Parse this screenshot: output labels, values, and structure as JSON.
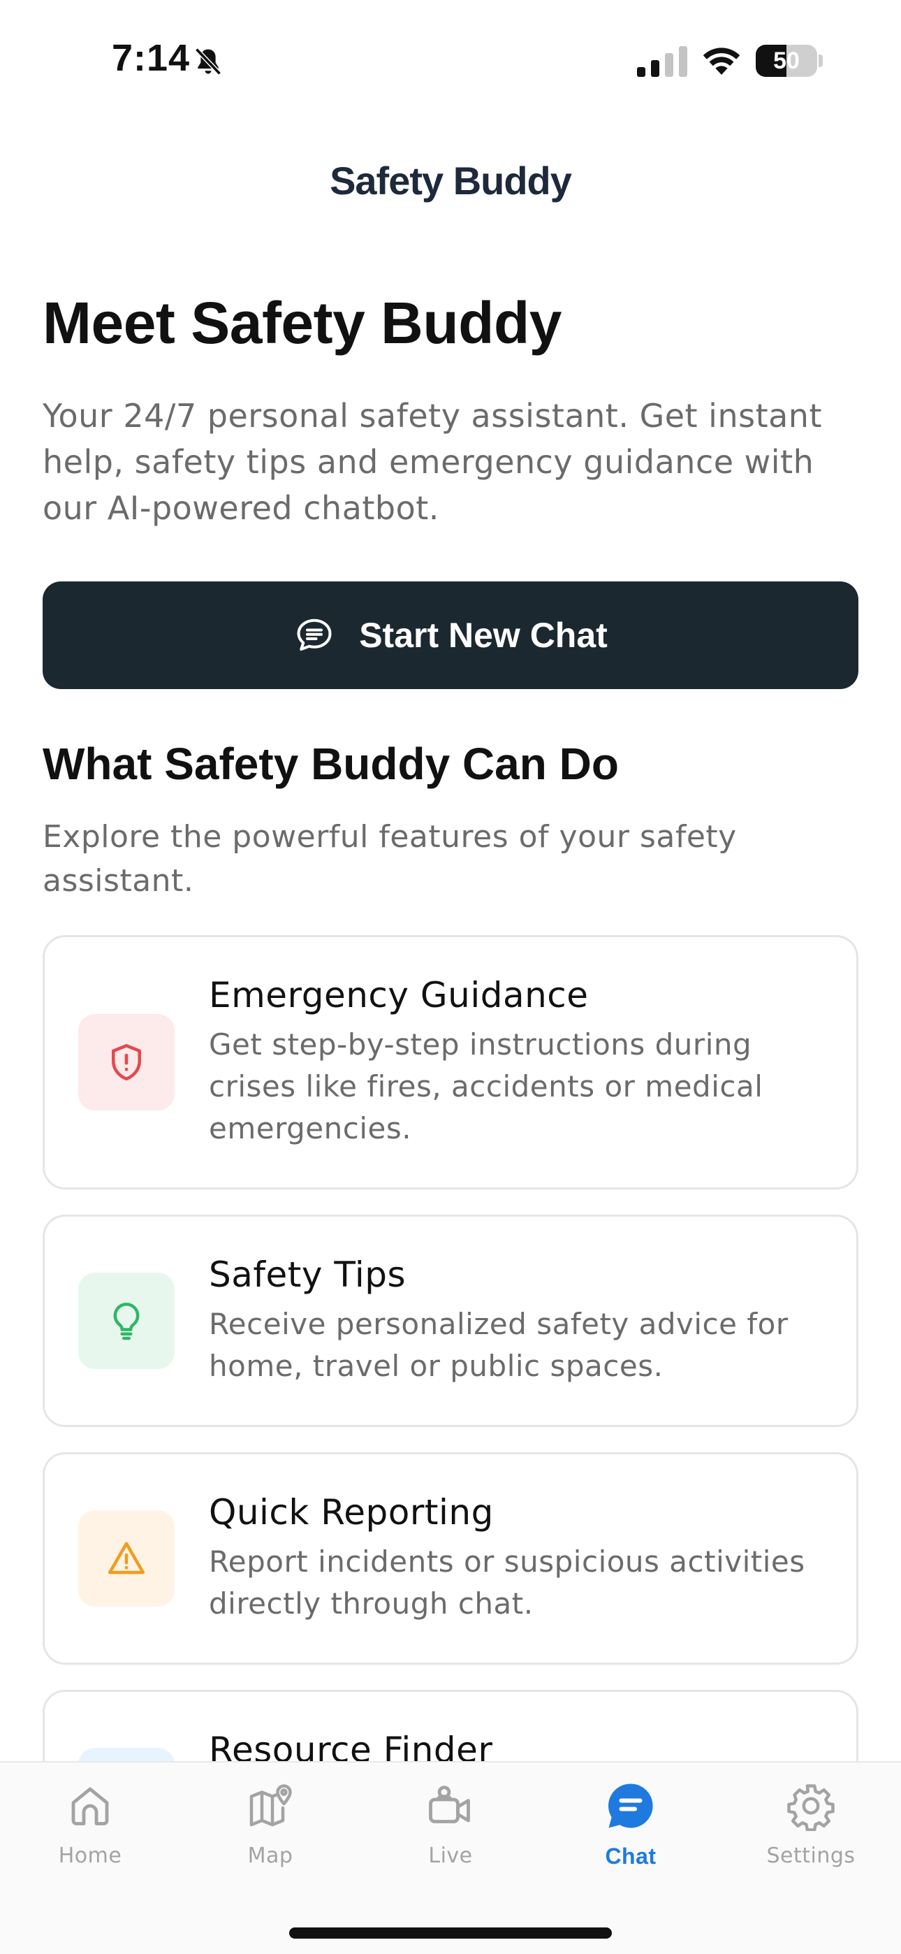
{
  "status_bar": {
    "time": "7:14",
    "battery_level": "50",
    "battery_fraction": 0.5
  },
  "header": {
    "title": "Safety Buddy"
  },
  "hero": {
    "title": "Meet Safety Buddy",
    "description": "Your 24/7 personal safety assistant. Get instant help, safety tips and emergency guidance with our AI-powered chatbot.",
    "button_label": "Start New Chat",
    "button_icon": "chat-bubble-icon"
  },
  "features": {
    "title": "What Safety Buddy Can Do",
    "description": "Explore the powerful features of your safety assistant.",
    "cards": [
      {
        "title": "Emergency Guidance",
        "description": "Get step-by-step instructions during crises like fires, accidents or medical emergencies.",
        "icon": "shield-alert-icon",
        "icon_color": "#e5484d",
        "icon_bg": "#fdeaea"
      },
      {
        "title": "Safety Tips",
        "description": "Receive personalized safety advice for home, travel or public spaces.",
        "icon": "lightbulb-icon",
        "icon_color": "#2fb766",
        "icon_bg": "#e8f7ee"
      },
      {
        "title": "Quick Reporting",
        "description": "Report incidents or suspicious activities directly through chat.",
        "icon": "warning-triangle-icon",
        "icon_color": "#f29b1d",
        "icon_bg": "#fff3e6"
      },
      {
        "title": "Resource Finder",
        "description": "",
        "icon": "search-icon",
        "icon_color": "#2b8fe0",
        "icon_bg": "#e8f4fd"
      }
    ]
  },
  "tab_bar": {
    "active": "Chat",
    "active_color": "#1f7ae0",
    "inactive_color": "#a3a3a3",
    "tabs": [
      {
        "label": "Home",
        "icon": "home-icon"
      },
      {
        "label": "Map",
        "icon": "map-icon"
      },
      {
        "label": "Live",
        "icon": "video-camera-icon"
      },
      {
        "label": "Chat",
        "icon": "chat-icon"
      },
      {
        "label": "Settings",
        "icon": "gear-icon"
      }
    ]
  }
}
